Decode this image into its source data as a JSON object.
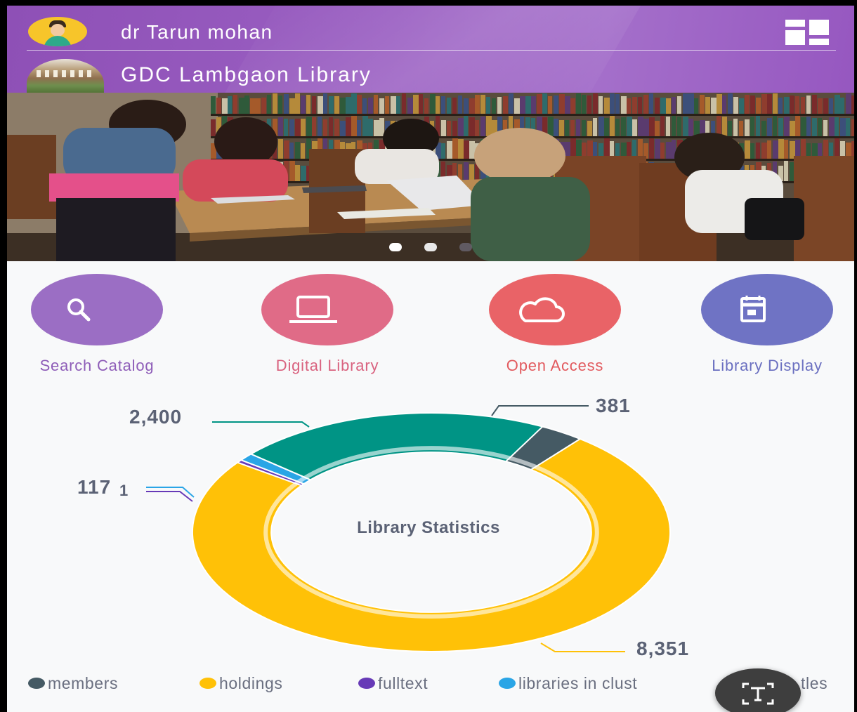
{
  "header": {
    "user_name": "dr Tarun mohan",
    "library_name": "GDC Lambgaon Library",
    "menu_icon": "grid-menu-icon"
  },
  "banner": {
    "slide_count": 3,
    "active_slide": 1
  },
  "actions": [
    {
      "label": "Search Catalog",
      "icon": "search-icon",
      "color": "#9b6ec4",
      "text_color": "#8e5db8"
    },
    {
      "label": "Digital Library",
      "icon": "laptop-icon",
      "color": "#e06b87",
      "text_color": "#d9627f"
    },
    {
      "label": "Open Access",
      "icon": "cloud-icon",
      "color": "#e96367",
      "text_color": "#e25a5e"
    },
    {
      "label": "Library Display",
      "icon": "calendar-icon",
      "color": "#6f73c4",
      "text_color": "#6a6fc0"
    }
  ],
  "chart_data": {
    "type": "pie",
    "title": "Library Statistics",
    "series": [
      {
        "name": "members",
        "value": 381,
        "label": "381",
        "color": "#455a64"
      },
      {
        "name": "holdings",
        "value": 8351,
        "label": "8,351",
        "color": "#ffc107"
      },
      {
        "name": "fulltext",
        "value": 1,
        "label": "1",
        "color": "#673ab7"
      },
      {
        "name": "libraries in cluster",
        "value": 117,
        "label": "117",
        "color": "#2aa5e6"
      },
      {
        "name": "titles",
        "value": 2400,
        "label": "2,400",
        "color": "#009485"
      }
    ],
    "legend": [
      "members",
      "holdings",
      "fulltext",
      "libraries in clust",
      "tles"
    ],
    "legend_placement": "bottom"
  }
}
